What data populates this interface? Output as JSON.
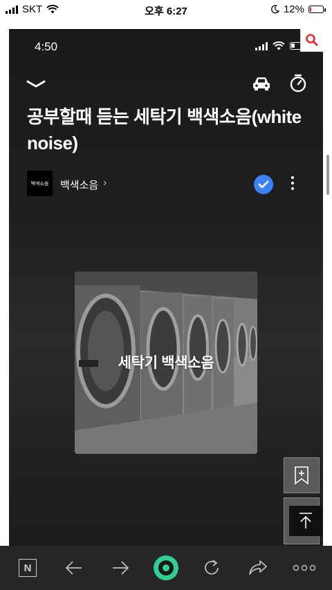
{
  "status_bar": {
    "carrier": "SKT",
    "time": "오후 6:27",
    "battery": "12%",
    "battery_level": 0.12
  },
  "inner_status": {
    "time": "4:50"
  },
  "video": {
    "title": "공부할때 듣는 세탁기 백색소음(white noise)",
    "channel_name": "백색소음",
    "channel_logo_text": "백색소음",
    "artwork_caption": "세탁기 백색소음"
  },
  "icons": {
    "collapse": "chevron-down-icon",
    "car_mode": "car-icon",
    "sleep_timer": "timer-icon",
    "verified": "check-icon",
    "more": "more-vertical-icon",
    "search": "search-icon",
    "bookmark_add": "bookmark-add-icon",
    "scroll_top": "arrow-up-icon"
  },
  "colors": {
    "search_accent": "#e8282b",
    "verify_badge": "#3b82f6",
    "home_ring": "#2fd08f",
    "battery_low": "#e0201c"
  },
  "bottom_bar": {
    "n_label": "N"
  }
}
